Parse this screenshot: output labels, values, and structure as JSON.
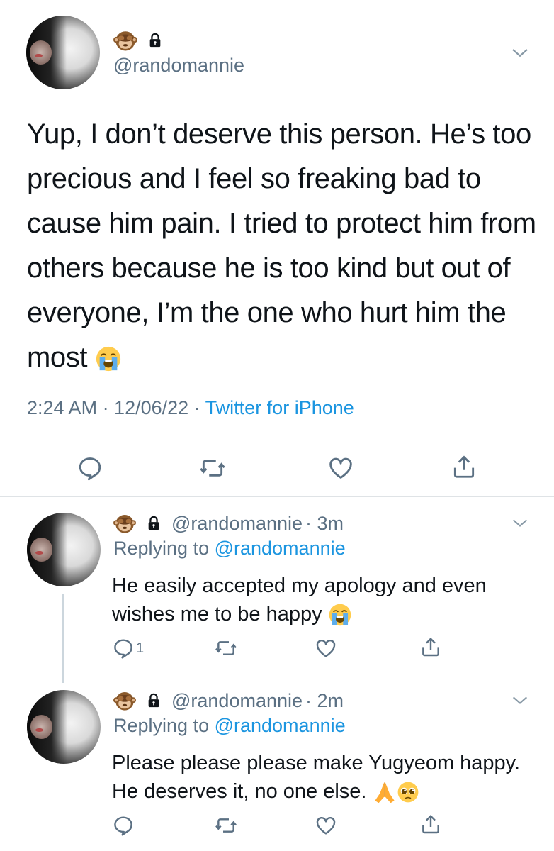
{
  "main_tweet": {
    "handle": "@randomannie",
    "text": "Yup, I don’t deserve this person. He’s too precious and I feel so freaking bad to cause him pain. I tried to protect him from others because he is too kind but out of everyone, I’m the one who hurt him the most",
    "timestamp": "2:24 AM · 12/06/22 · ",
    "client": "Twitter for iPhone"
  },
  "replies": [
    {
      "handle": "@randomannie",
      "time": "· 3m",
      "replying_prefix": "Replying to ",
      "replying_to": "@randomannie",
      "text": "He easily accepted my apology and even wishes me to be happy",
      "reply_count": "1"
    },
    {
      "handle": "@randomannie",
      "time": "· 2m",
      "replying_prefix": "Replying to ",
      "replying_to": "@randomannie",
      "text": "Please please please make Yugyeom happy. He deserves it, no one else.",
      "reply_count": ""
    }
  ],
  "icons": {
    "name_emoji": "see-no-evil-monkey",
    "lock": "lock-icon",
    "crying": "loudly-crying-face",
    "pray": "folded-hands",
    "pleading": "pleading-face"
  },
  "colors": {
    "link": "#1b95e0",
    "secondary": "#5b7083",
    "divider": "#dfe3e6"
  }
}
